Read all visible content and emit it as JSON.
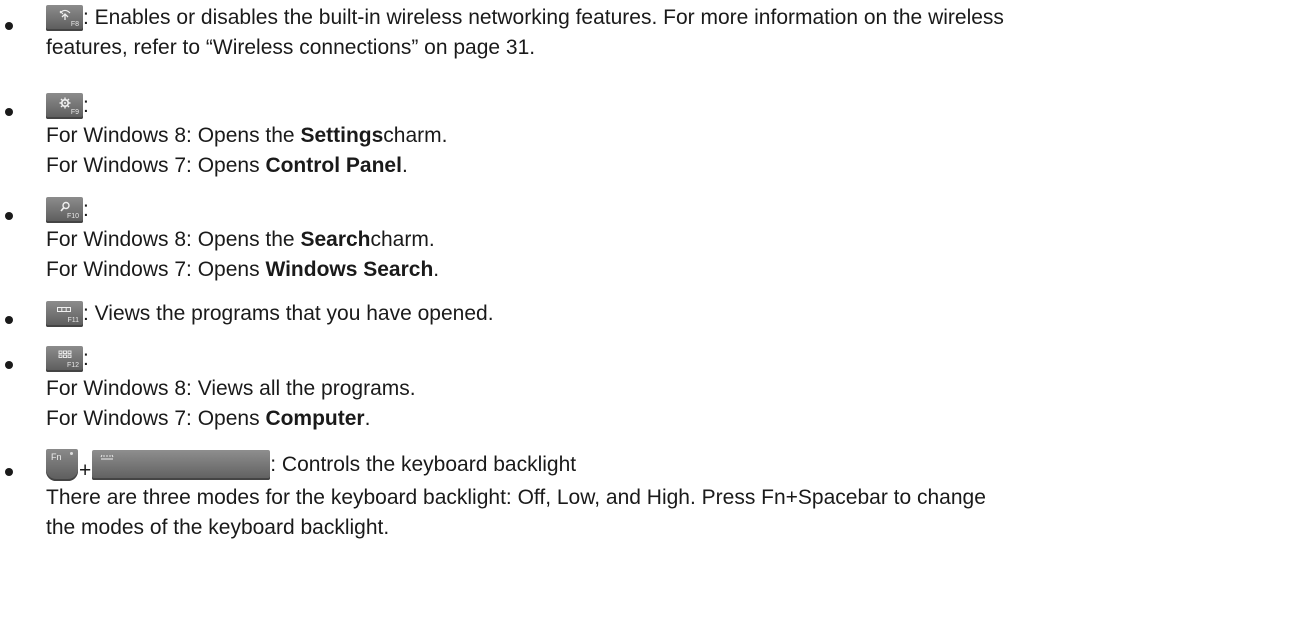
{
  "items": [
    {
      "key_label": "F8",
      "key_icon": "wireless-icon",
      "line1": ": Enables or disables the built-in wireless networking features. For more information on the wireless",
      "line2": "features, refer to “Wireless connections” on page 31."
    },
    {
      "key_label": "F9",
      "key_icon": "gear-icon",
      "colon": ":",
      "win8_prefix": "For Windows 8: Opens the ",
      "win8_bold": "Settings",
      "win8_suffix": " charm.",
      "win7_prefix": "For Windows 7: Opens ",
      "win7_bold": "Control Panel",
      "win7_suffix": "."
    },
    {
      "key_label": "F10",
      "key_icon": "search-icon",
      "colon": ":",
      "win8_prefix": "For Windows 8: Opens the ",
      "win8_bold": "Search",
      "win8_suffix": " charm.",
      "win7_prefix": "For Windows 7: Opens ",
      "win7_bold": "Windows Search",
      "win7_suffix": "."
    },
    {
      "key_label": "F11",
      "key_icon": "open-programs-icon",
      "line1": ": Views the programs that you have opened."
    },
    {
      "key_label": "F12",
      "key_icon": "all-programs-icon",
      "colon": ":",
      "win8_text": "For Windows 8: Views all the programs.",
      "win7_prefix": "For Windows 7: Opens ",
      "win7_bold": "Computer",
      "win7_suffix": "."
    },
    {
      "fn_label": "Fn",
      "plus": "+",
      "space_icon": "keyboard-backlight-icon",
      "line1": ": Controls the keyboard backlight",
      "line2": "There are three modes for the keyboard backlight: Off, Low, and High. Press Fn+Spacebar to change",
      "line3": "the modes of the keyboard backlight."
    }
  ]
}
